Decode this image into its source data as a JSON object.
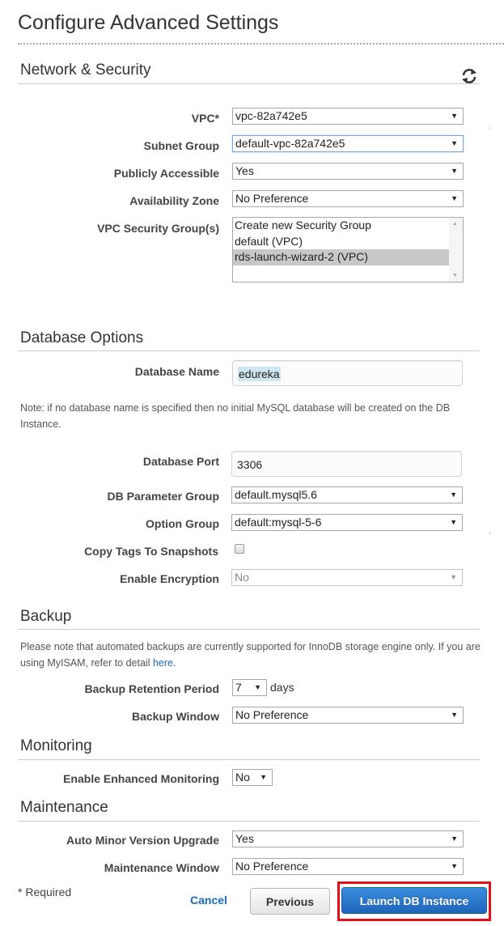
{
  "page": {
    "title": "Configure Advanced Settings"
  },
  "colors": {
    "link": "#1a6bb8",
    "primary_button": "#2a7ad0",
    "highlight_box": "#e3101c",
    "selected_option": "#c8c8c8"
  },
  "network_security": {
    "title": "Network & Security",
    "refresh_icon": "refresh-icon",
    "vpc": {
      "label": "VPC*",
      "value": "vpc-82a742e5"
    },
    "subnet_group": {
      "label": "Subnet Group",
      "value": "default-vpc-82a742e5"
    },
    "publicly_accessible": {
      "label": "Publicly Accessible",
      "value": "Yes"
    },
    "availability_zone": {
      "label": "Availability Zone",
      "value": "No Preference"
    },
    "security_groups": {
      "label": "VPC Security Group(s)",
      "options": [
        {
          "label": "Create new Security Group",
          "selected": false
        },
        {
          "label": "default (VPC)",
          "selected": false
        },
        {
          "label": "rds-launch-wizard-2 (VPC)",
          "selected": true
        }
      ]
    }
  },
  "database_options": {
    "title": "Database Options",
    "database_name": {
      "label": "Database Name",
      "value": "edureka"
    },
    "note": "Note: if no database name is specified then no initial MySQL database will be created on the DB Instance.",
    "database_port": {
      "label": "Database Port",
      "value": "3306"
    },
    "parameter_group": {
      "label": "DB Parameter Group",
      "value": "default.mysql5.6"
    },
    "option_group": {
      "label": "Option Group",
      "value": "default:mysql-5-6"
    },
    "copy_tags": {
      "label": "Copy Tags To Snapshots",
      "checked": false
    },
    "encryption": {
      "label": "Enable Encryption",
      "value": "No",
      "disabled": true
    }
  },
  "backup": {
    "title": "Backup",
    "note_text": "Please note that automated backups are currently supported for InnoDB storage engine only. If you are using MyISAM, refer to detail",
    "note_link": "here",
    "note_end": ".",
    "retention": {
      "label": "Backup Retention Period",
      "value": "7",
      "suffix": "days"
    },
    "window": {
      "label": "Backup Window",
      "value": "No Preference"
    }
  },
  "monitoring": {
    "title": "Monitoring",
    "enhanced": {
      "label": "Enable Enhanced Monitoring",
      "value": "No"
    }
  },
  "maintenance": {
    "title": "Maintenance",
    "auto_minor": {
      "label": "Auto Minor Version Upgrade",
      "value": "Yes"
    },
    "window": {
      "label": "Maintenance Window",
      "value": "No Preference"
    }
  },
  "footer": {
    "required_note": "* Required",
    "cancel": "Cancel",
    "previous": "Previous",
    "launch": "Launch DB Instance"
  }
}
